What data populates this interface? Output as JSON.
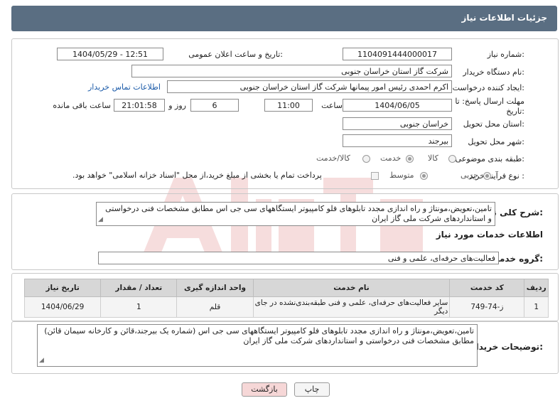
{
  "header": {
    "title": "جزئیات اطلاعات نیاز"
  },
  "form": {
    "need_number": {
      "label": "شماره نیاز:",
      "value": "1104091444000017"
    },
    "announce": {
      "label": "تاریخ و ساعت اعلان عمومی:",
      "value": "1404/05/29 - 12:51"
    },
    "buyer_org": {
      "label": "نام دستگاه خریدار:",
      "value": "شرکت گاز استان خراسان جنوبی"
    },
    "requester": {
      "label": "ایجاد کننده درخواست:",
      "value": "اکرم احمدی رئیس امور پیمانها شرکت گاز استان خراسان جنوبی",
      "contact_link": "اطلاعات تماس خریدار"
    },
    "deadline": {
      "label_line1": "مهلت ارسال پاسخ: تا",
      "label_line2": "تاریخ:",
      "date": "1404/06/05",
      "time_label": "ساعت",
      "time": "11:00",
      "days": "6",
      "days_label": "روز و",
      "remaining": "21:01:58",
      "remaining_label": "ساعت باقی مانده"
    },
    "province": {
      "label": "استان محل تحویل:",
      "value": "خراسان جنوبی"
    },
    "city": {
      "label": "شهر محل تحویل:",
      "value": "بیرجند"
    },
    "category": {
      "label": "طبقه بندی موضوعی:",
      "options": [
        "کالا",
        "خدمت",
        "کالا/خدمت"
      ],
      "selected": "خدمت"
    },
    "process": {
      "label": "نوع فرآیند خرید :",
      "options": [
        "جزیی",
        "متوسط"
      ],
      "selected": "جزیی",
      "payment_note": "پرداخت تمام یا بخشی از مبلغ خرید،از محل \"اسناد خزانه اسلامی\" خواهد بود."
    }
  },
  "summary": {
    "label": "شرح کلی نیاز:",
    "text": "تامین،تعویض،مونتاژ و راه اندازی مجدد تابلوهای فلو کامپیوتر ایستگاههای سی جی اس  مطابق مشخصات فنی درخواستی و استانداردهای شرکت ملی گاز ایران"
  },
  "services": {
    "section_title": "اطلاعات خدمات مورد نیاز",
    "group_label": "گروه خدمت:",
    "group_value": "فعالیت‌های حرفه‌ای، علمی و فنی",
    "columns": [
      "ردیف",
      "کد خدمت",
      "نام خدمت",
      "واحد اندازه گیری",
      "تعداد / مقدار",
      "تاریخ نیاز"
    ],
    "rows": [
      {
        "row": "1",
        "code": "ز-74-749",
        "name": "سایر فعالیت‌های حرفه‌ای، علمی و فنی طبقه‌بندی‌نشده در جای دیگر",
        "unit": "قلم",
        "qty": "1",
        "date": "1404/06/29"
      }
    ]
  },
  "buyer_notes": {
    "label": "توضیحات خریدار:",
    "text": "تامین،تعویض،مونتاژ و راه اندازی مجدد تابلوهای فلو کامپیوتر ایستگاههای سی جی اس (شماره یک بیرجند،قائن و کارخانه سیمان قائن) مطابق مشخصات فنی درخواستی و استانداردهای شرکت ملی گاز ایران"
  },
  "buttons": {
    "print": "چاپ",
    "back": "بازگشت"
  },
  "colors": {
    "header_bg": "#5a6e82",
    "link": "#1a5aa8",
    "back_bg": "#f6d7d7"
  }
}
